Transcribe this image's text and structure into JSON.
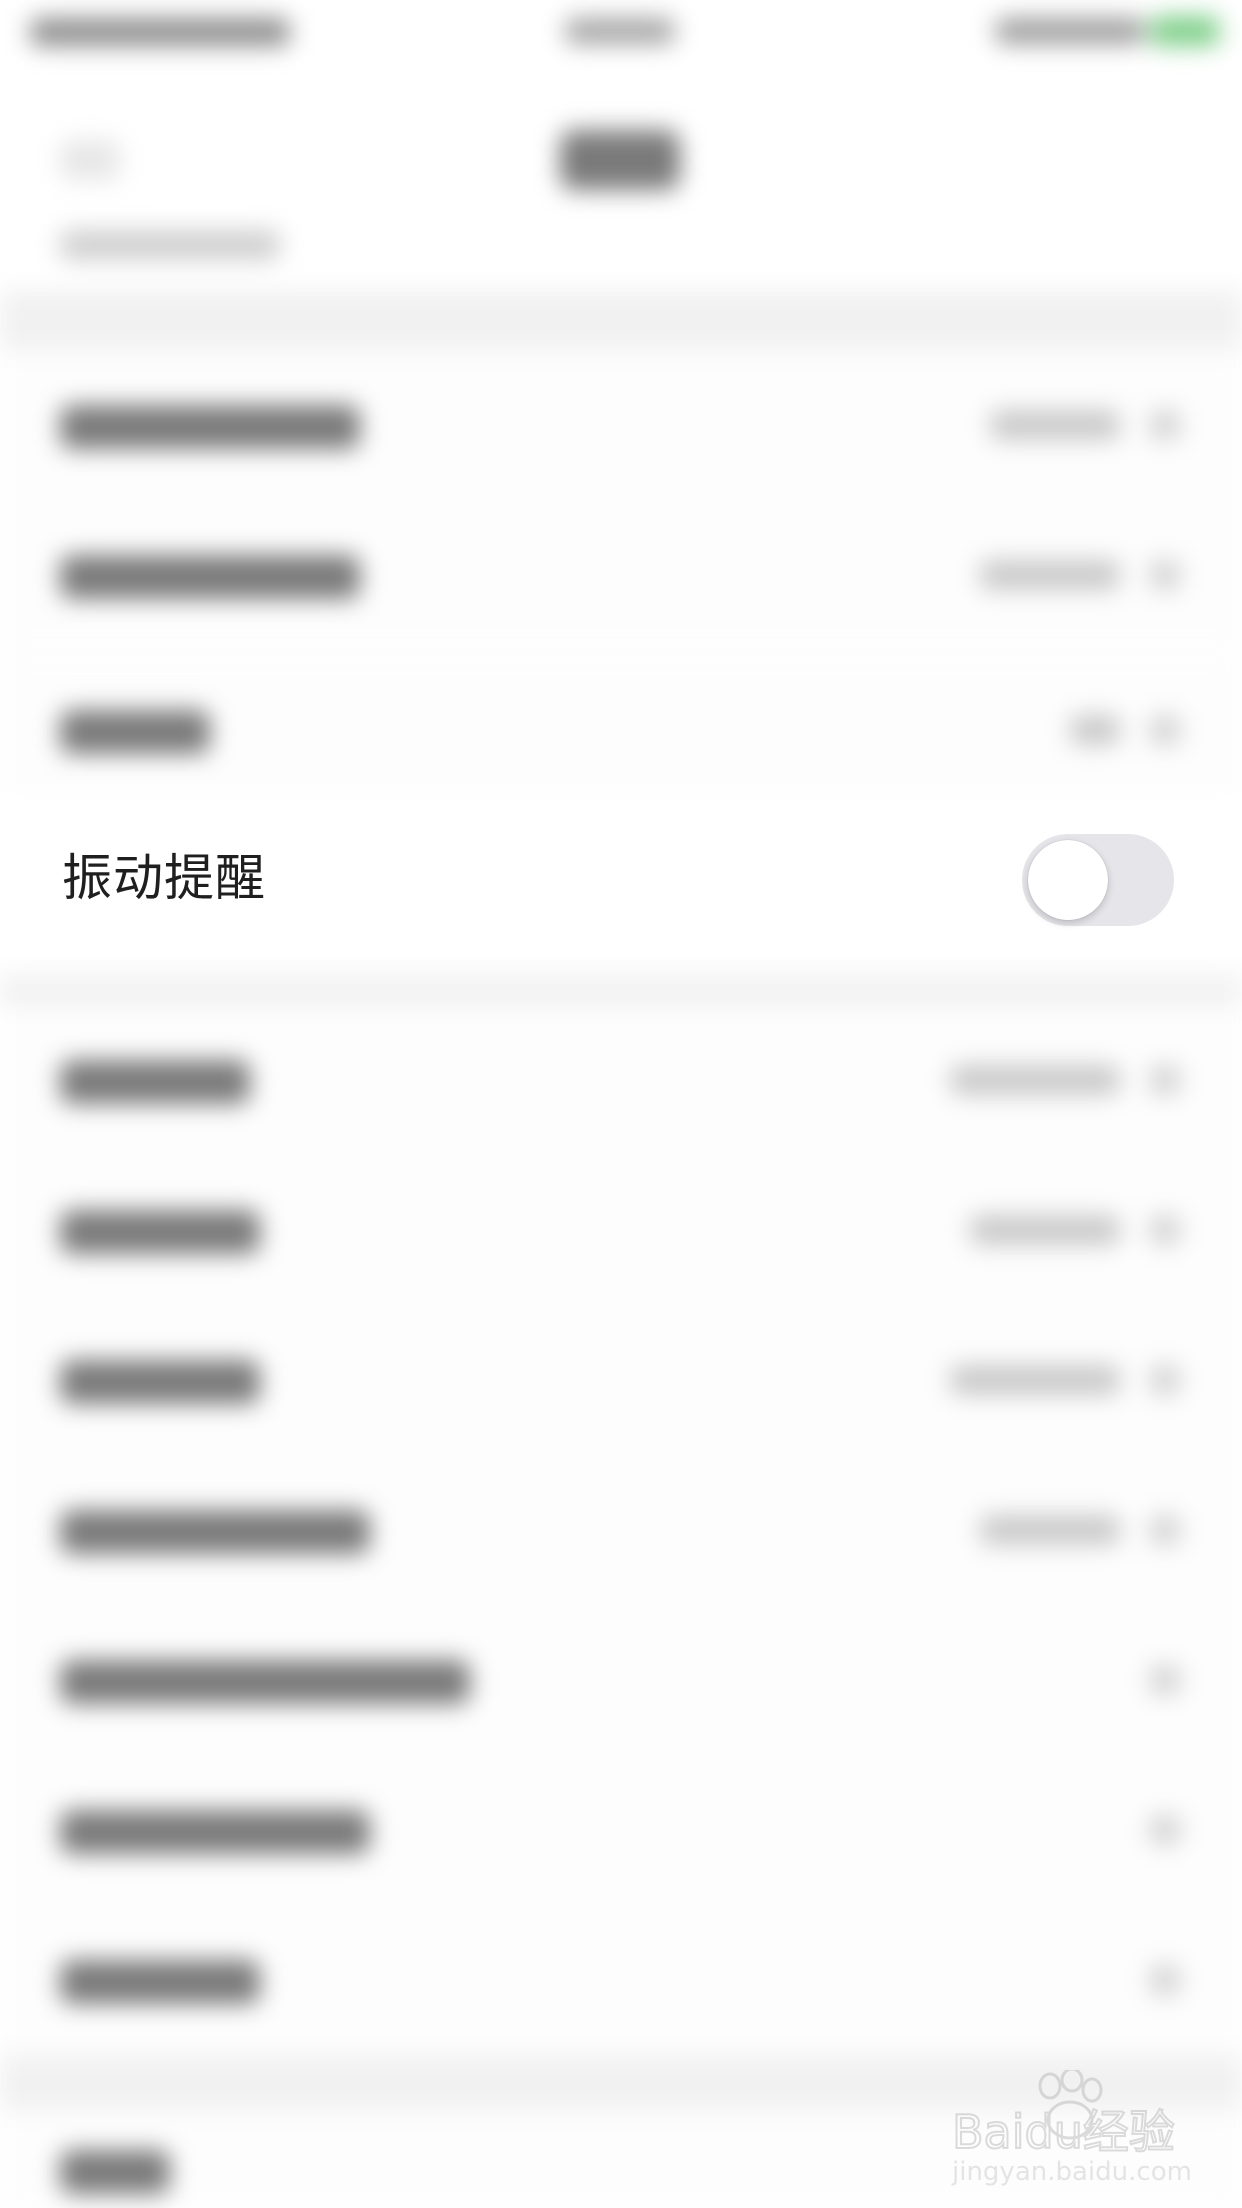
{
  "settings": {
    "vibration_row": {
      "label": "振动提醒",
      "toggle_on": false
    }
  },
  "colors": {
    "toggle_off_track": "#e5e5ea",
    "toggle_knob": "#ffffff",
    "status_battery": "#7fcf8a"
  },
  "watermark": {
    "brand": "Baidu经验",
    "url": "jingyan.baidu.com"
  }
}
